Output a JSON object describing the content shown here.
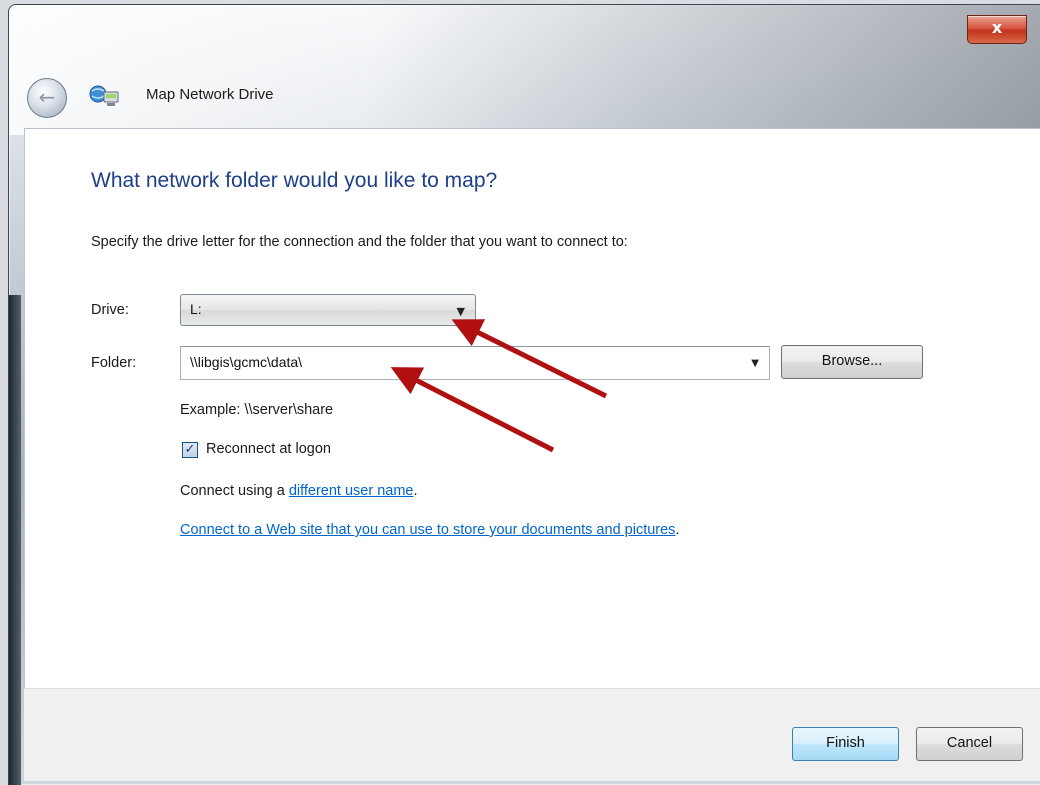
{
  "window": {
    "title": "Map Network Drive",
    "close_glyph": "x",
    "back_glyph": "←"
  },
  "main": {
    "heading": "What network folder would you like to map?",
    "instructions": "Specify the drive letter for the connection and the folder that you want to connect to:",
    "drive": {
      "label": "Drive:",
      "value": "L:"
    },
    "folder": {
      "label": "Folder:",
      "value": "\\\\libgis\\gcmc\\data\\"
    },
    "browse_label": "Browse...",
    "example": "Example: \\\\server\\share",
    "reconnect": {
      "label": "Reconnect at logon",
      "checked": true
    },
    "connect_prefix": "Connect using a ",
    "connect_link": "different user name",
    "connect_suffix": ".",
    "web_link": "Connect to a Web site that you can use to store your documents and pictures",
    "web_suffix": "."
  },
  "footer": {
    "finish_label": "Finish",
    "cancel_label": "Cancel"
  },
  "annotation": {
    "arrow_color": "#b01010"
  }
}
